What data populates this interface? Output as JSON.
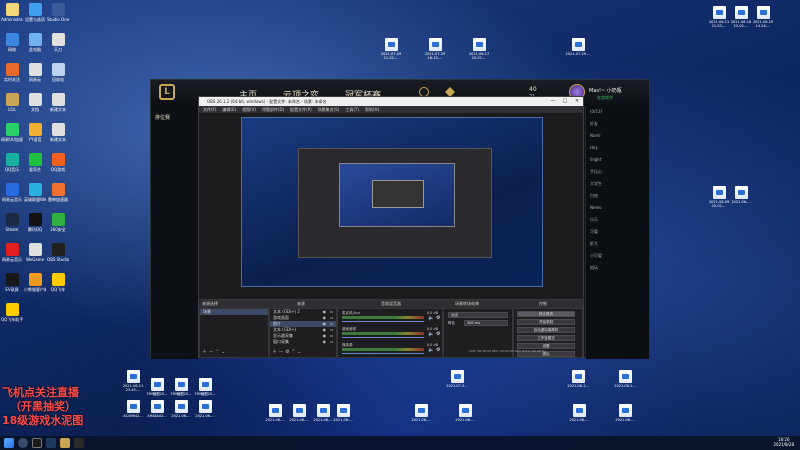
{
  "desktop_left_icons": [
    {
      "label": "Administra...",
      "color": "#f0d77a"
    },
    {
      "label": "设置与选项",
      "color": "#3fa0f0"
    },
    {
      "label": "Studio One",
      "color": "#3a5a9a"
    },
    {
      "label": "网络",
      "color": "#3d86e0"
    },
    {
      "label": "此电脑",
      "color": "#6fb2f0"
    },
    {
      "label": "天刀",
      "color": "#e0e0e0"
    },
    {
      "label": "实时关注",
      "color": "#e96a2a"
    },
    {
      "label": "网易云",
      "color": "#e0e0e0"
    },
    {
      "label": "回收站",
      "color": "#bcd4f0"
    },
    {
      "label": "LOL",
      "color": "#c8a656"
    },
    {
      "label": "文档",
      "color": "#e0e0e0"
    },
    {
      "label": "新建文本",
      "color": "#e0e0e0"
    },
    {
      "label": "网易UU加速器",
      "color": "#2ad06a"
    },
    {
      "label": "YY语音",
      "color": "#f0b030"
    },
    {
      "label": "新建文本",
      "color": "#e0e0e0"
    },
    {
      "label": "QQ音乐",
      "color": "#1ab0a0"
    },
    {
      "label": "爱奇艺",
      "color": "#20c040"
    },
    {
      "label": "QQ游戏",
      "color": "#f06020"
    },
    {
      "label": "网易云音乐",
      "color": "#2a6ae0"
    },
    {
      "label": "英雄联盟WeGame",
      "color": "#2ab0e0"
    },
    {
      "label": "雷神加速器",
      "color": "#f07030"
    },
    {
      "label": "Steam",
      "color": "#1b2a44"
    },
    {
      "label": "腾讯QQ",
      "color": "#121212"
    },
    {
      "label": "360安全",
      "color": "#30b040"
    },
    {
      "label": "网易云音乐",
      "color": "#e02020"
    },
    {
      "label": "WeGame",
      "color": "#e0e0e0"
    },
    {
      "label": "OBS Studio",
      "color": "#202020"
    },
    {
      "label": "EV录屏",
      "color": "#181818"
    },
    {
      "label": "小熊猫客户端",
      "color": "#f09a20"
    },
    {
      "label": "QQ飞车",
      "color": "#ffcc00"
    },
    {
      "label": "QQ飞车助手",
      "color": "#ffcc00"
    }
  ],
  "desktop_file_icons": [
    {
      "label": "2021-06-11 21-53-..."
    },
    {
      "label": "2021-06-16 20-02-..."
    },
    {
      "label": "2021-06-15 14-24-..."
    },
    {
      "label": "2021-06-09 20-02-..."
    },
    {
      "label": "2021-07-29 21-22-..."
    },
    {
      "label": "2021-07-29 16-15-..."
    },
    {
      "label": "2021-06-17 20-07-..."
    },
    {
      "label": "2021-07-29 ..."
    },
    {
      "label": "2021-06-11 23-45-..."
    },
    {
      "label": "TIM截图20..."
    },
    {
      "label": "TIM截图20..."
    },
    {
      "label": "TIM截图20..."
    },
    {
      "label": "2021-06-1..."
    },
    {
      "label": "2021-07-3..."
    },
    {
      "label": "2021-06-1..."
    },
    {
      "label": "AC49B42..."
    },
    {
      "label": "A948A02..."
    },
    {
      "label": "2021-06-..."
    },
    {
      "label": "2021-06-..."
    },
    {
      "label": "2021-06-..."
    },
    {
      "label": "2021-06-..."
    },
    {
      "label": "2021-06-..."
    },
    {
      "label": "2021-06-..."
    },
    {
      "label": "2021-06-..."
    },
    {
      "label": "2021-06-..."
    },
    {
      "label": "2021-06-..."
    },
    {
      "label": "2021-06-..."
    },
    {
      "label": "2021-06-..."
    }
  ],
  "overlay_text": [
    "飞机点关注直播",
    "（开黑抽奖）",
    "18级游戏水泥图"
  ],
  "lol_client": {
    "nav": [
      "主页",
      "云顶之弈",
      "冠军杯赛"
    ],
    "currency": "40",
    "currency_secondary": "21",
    "username": "Mas!~ 小奶瓶",
    "status": "在游戏中",
    "left_label": "排位赛",
    "social_rows": [
      "(0/13)",
      "好友",
      "Nami",
      "Hey",
      "Slight",
      "手比心",
      "大学生",
      "白给",
      "Nemo",
      "乐乐",
      "可爱",
      "虾大",
      "小可爱",
      "陪玩"
    ]
  },
  "obs": {
    "title": "OBS 26.1.2 (64-bit, windows) - 配置文件: 未命名 - 场景: 未命名",
    "win_buttons": [
      "—",
      "□",
      "×"
    ],
    "menu": [
      "文件(F)",
      "编辑(E)",
      "视图(V)",
      "停靠部件(D)",
      "配置文件(P)",
      "场景集合(S)",
      "工具(T)",
      "帮助(H)"
    ],
    "docks": {
      "scenes_header": "来源选择",
      "sources_header": "来源",
      "mixer_header": "音频混音器",
      "transitions_header": "场景转场效果",
      "controls_header": "控制"
    },
    "scenes": [
      "场景"
    ],
    "sources": [
      "文本 (GDI+) 2",
      "游戏画面",
      "图片",
      "文本 (GDI+)",
      "显示器采集",
      "窗口采集"
    ],
    "mixer": [
      {
        "name": "麦克风/Aux",
        "db": "0.0 dB"
      },
      {
        "name": "桌面音频",
        "db": "0.0 dB"
      },
      {
        "name": "媒体源",
        "db": "0.0 dB"
      }
    ],
    "transition": "淡出",
    "duration_label": "时长",
    "duration": "300 ms",
    "controls": [
      "停止推流",
      "开始录制",
      "启动虚拟摄像机",
      "工作室模式",
      "设置",
      "退出"
    ],
    "status": "LIVE: 00:36:00  REC: 00:00:00  CPU: 8.0%, 60.00 fps"
  },
  "taskbar": {
    "time": "18:26",
    "date": "2021/8/28"
  }
}
